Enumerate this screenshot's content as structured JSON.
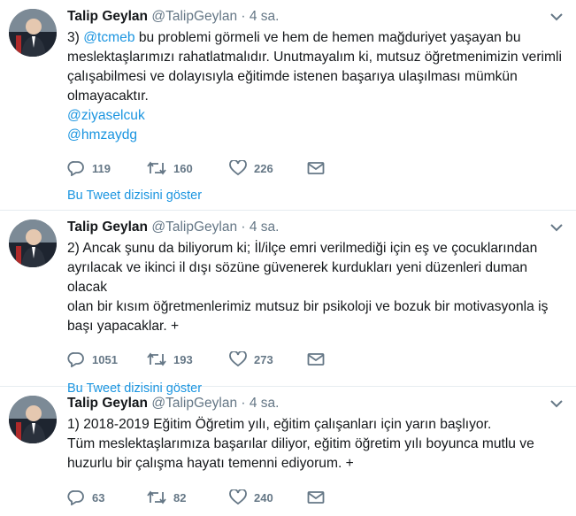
{
  "tweets": [
    {
      "name": "Talip Geylan",
      "handle": "@TalipGeylan",
      "separator": "·",
      "time": "4 sa.",
      "lines": [
        [
          "3) ",
          "@tcmeb",
          " bu problemi görmeli ve hem de hemen mağduriyet yaşayan bu"
        ],
        [
          "meslektaşlarımızı rahatlatmalıdır. Unutmayalım ki, mutsuz öğretmenimizin verimli"
        ],
        [
          "çalışabilmesi ve dolayısıyla eğitimde istenen başarıya ulaşılması mümkün"
        ],
        [
          "olmayacaktır."
        ]
      ],
      "mentions": [
        "@ziyaselcuk",
        "@hmzaydg"
      ],
      "reply_count": "119",
      "retweet_count": "160",
      "like_count": "226",
      "thread_link": "Bu Tweet dizisini göster"
    },
    {
      "name": "Talip Geylan",
      "handle": "@TalipGeylan",
      "separator": "·",
      "time": "4 sa.",
      "lines": [
        "2) Ancak şunu da biliyorum ki; İl/ilçe emri verilmediği için eş ve çocuklarından",
        "ayrılacak ve ikinci il dışı sözüne güvenerek kurdukları yeni düzenleri duman olacak",
        "olan bir kısım öğretmenlerimiz mutsuz bir psikoloji ve bozuk bir motivasyonla iş",
        "başı yapacaklar. +"
      ],
      "reply_count": "1051",
      "retweet_count": "193",
      "like_count": "273",
      "thread_link": "Bu Tweet dizisini göster"
    },
    {
      "name": "Talip Geylan",
      "handle": "@TalipGeylan",
      "separator": "·",
      "time": "4 sa.",
      "lines": [
        "1) 2018-2019 Eğitim Öğretim yılı, eğitim çalışanları için yarın başlıyor.",
        "Tüm meslektaşlarımıza başarılar diliyor, eğitim öğretim yılı boyunca mutlu ve",
        "huzurlu bir çalışma hayatı temenni ediyorum. +"
      ],
      "reply_count": "63",
      "retweet_count": "82",
      "like_count": "240"
    }
  ],
  "icons": {
    "reply": "reply-icon",
    "retweet": "retweet-icon",
    "like": "heart-icon",
    "dm": "envelope-icon",
    "menu": "chevron-down-icon"
  },
  "colors": {
    "link": "#1b95e0",
    "secondary": "#657786",
    "text": "#14171a",
    "divider": "#e6ecf0"
  }
}
